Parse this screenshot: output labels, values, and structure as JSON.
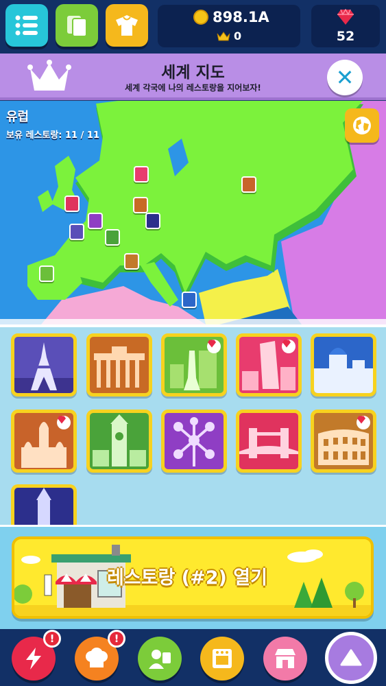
{
  "top_bar": {
    "coins": "898.1A",
    "crowns": "0",
    "gems": "52",
    "icons": [
      "menu-list-icon",
      "cards-icon",
      "shirt-icon",
      "coin-icon",
      "crown-icon",
      "gem-icon"
    ]
  },
  "banner": {
    "title": "세계 지도",
    "subtitle": "세계 각국에 나의 레스토랑을 지어보자!"
  },
  "map": {
    "region_name": "유럽",
    "owned_label": "보유 레스토랑: 11 / 11",
    "colors": {
      "sea": "#2d95e6",
      "europe": "#7cf23c",
      "asia": "#d77ce6",
      "africa": "#f4f04a"
    }
  },
  "restaurants": [
    {
      "name": "paris",
      "icon": "eiffel-tower-icon",
      "sky": "#5a4fb8",
      "gem": false
    },
    {
      "name": "berlin",
      "icon": "brandenburg-gate-icon",
      "sky": "#c86a25",
      "gem": false
    },
    {
      "name": "copenhagen",
      "icon": "little-mermaid-icon",
      "sky": "#6bbf3a",
      "gem": true
    },
    {
      "name": "hamburg",
      "icon": "dancing-tower-icon",
      "sky": "#e83c6e",
      "gem": true
    },
    {
      "name": "santorini",
      "icon": "santorini-church-icon",
      "sky": "#2c66c9",
      "gem": false
    },
    {
      "name": "moscow",
      "icon": "saint-basil-icon",
      "sky": "#c8632a",
      "gem": true
    },
    {
      "name": "bern",
      "icon": "clock-tower-icon",
      "sky": "#4aa33a",
      "gem": false
    },
    {
      "name": "brussels",
      "icon": "atomium-icon",
      "sky": "#8f3ec4",
      "gem": false
    },
    {
      "name": "london",
      "icon": "tower-bridge-icon",
      "sky": "#e0335e",
      "gem": false
    },
    {
      "name": "rome",
      "icon": "colosseum-icon",
      "sky": "#c27a2a",
      "gem": true
    },
    {
      "name": "prague",
      "icon": "prague-tower-icon",
      "sky": "#2c2f8c",
      "gem": false
    }
  ],
  "open_button": {
    "label": "레스토랑 (#2) 열기"
  },
  "bottom_nav": {
    "alert_mark": "!",
    "items": [
      "lightning-icon",
      "chef-hat-icon",
      "manager-icon",
      "oven-icon",
      "shop-icon",
      "up-arrow-icon"
    ]
  }
}
